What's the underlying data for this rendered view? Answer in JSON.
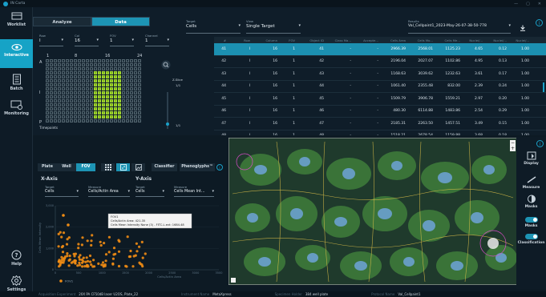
{
  "app": {
    "title": "IN Carta",
    "window_controls": [
      "—",
      "▢",
      "✕"
    ]
  },
  "nav": [
    {
      "id": "worklist",
      "label": "Worklist",
      "icon": "folder-icon"
    },
    {
      "id": "interactive",
      "label": "Interactive",
      "icon": "eye-icon",
      "active": true
    },
    {
      "id": "batch",
      "label": "Batch",
      "icon": "document-icon"
    },
    {
      "id": "monitoring",
      "label": "Monitoring",
      "icon": "monitor-icon"
    },
    {
      "id": "help",
      "label": "Help",
      "icon": "help-icon"
    },
    {
      "id": "settings",
      "label": "Settings",
      "icon": "gear-icon"
    }
  ],
  "view_toggle": {
    "analyze": "Analyze",
    "data": "Data"
  },
  "selectors": {
    "row": {
      "label": "Row",
      "value": "I"
    },
    "col": {
      "label": "Col",
      "value": "16"
    },
    "fov": {
      "label": "FOV",
      "value": "1"
    },
    "channel": {
      "label": "Channel",
      "value": "1"
    }
  },
  "plate": {
    "row_labels": [
      "A",
      "",
      "",
      "",
      "",
      "",
      "",
      "",
      "I",
      "",
      "",
      "",
      "",
      "",
      "",
      "P"
    ],
    "col_labels": [
      "1",
      "8",
      "16",
      "24"
    ],
    "timepoints_label": "Timepoints",
    "timepoints_value": "1/1",
    "zslice_label": "Z-Slice",
    "zslice_value": "1/1"
  },
  "data_header": {
    "target": {
      "label": "Target",
      "value": "Cells"
    },
    "view": {
      "label": "View",
      "value": "Single Target"
    },
    "results": {
      "label": "Results",
      "value": "Val_Cellpaint1_2023-May-26-07-38-50-778"
    }
  },
  "table": {
    "columns": [
      "#",
      "Row",
      "Column",
      "FOV",
      "Object ID",
      "Class Ma...",
      "Accepte...",
      "Cells Area",
      "Cells Mo...",
      "Cells Me...",
      "Nuclei/...",
      "Nuclei/...",
      "Nuclei/..."
    ],
    "rows": [
      [
        "41",
        "I",
        "16",
        "1",
        "41",
        "-",
        "-",
        "2966.39",
        "2568.01",
        "1125.23",
        "4.65",
        "0.12",
        "1.00"
      ],
      [
        "42",
        "I",
        "16",
        "1",
        "42",
        "-",
        "-",
        "2196.04",
        "2027.07",
        "1102.86",
        "4.95",
        "0.13",
        "1.00"
      ],
      [
        "43",
        "I",
        "16",
        "1",
        "43",
        "-",
        "-",
        "1168.63",
        "3039.62",
        "1232.63",
        "3.61",
        "0.17",
        "1.00"
      ],
      [
        "44",
        "I",
        "16",
        "1",
        "44",
        "-",
        "-",
        "1061.40",
        "2355.48",
        "832.00",
        "2.39",
        "0.24",
        "1.00"
      ],
      [
        "45",
        "I",
        "16",
        "1",
        "45",
        "-",
        "-",
        "1509.79",
        "3906.78",
        "1559.21",
        "2.97",
        "0.20",
        "1.00"
      ],
      [
        "46",
        "I",
        "16",
        "1",
        "46",
        "-",
        "-",
        "480.30",
        "6114.88",
        "1483.86",
        "2.54",
        "0.29",
        "1.00"
      ],
      [
        "47",
        "I",
        "16",
        "1",
        "47",
        "-",
        "-",
        "2185.31",
        "2263.50",
        "1457.51",
        "3.49",
        "0.15",
        "1.00"
      ],
      [
        "48",
        "I",
        "16",
        "1",
        "48",
        "-",
        "-",
        "1518.21",
        "2678.54",
        "1159.88",
        "3.68",
        "0.18",
        "1.00"
      ],
      [
        "49",
        "I",
        "16",
        "1",
        "49",
        "-",
        "-",
        "1144.40",
        "3697.48",
        "1353.87",
        "3.39",
        "0.18",
        "1.00"
      ]
    ],
    "selected_index": 0
  },
  "plot_tabs": {
    "plate": "Plate",
    "well": "Well",
    "fov": "FOV",
    "classifier": "Classifier",
    "phenoglyphs": "Phenoglyphs™"
  },
  "axes": {
    "x_title": "X-Axis",
    "y_title": "Y-Axis",
    "x_target": {
      "label": "Target",
      "value": "Cells"
    },
    "x_measure": {
      "label": "Measure",
      "value": "Cells/Actin Area"
    },
    "y_target": {
      "label": "Target",
      "value": "Cells"
    },
    "y_measure": {
      "label": "Measure",
      "value": "Cells Mean Int..."
    }
  },
  "scatter": {
    "xlabel": "Cells/Actin Area",
    "ylabel": "Cells Mean Intensity",
    "legend": "FOV1",
    "x_ticks": [
      "0",
      "500",
      "1000",
      "1500",
      "2000",
      "2500",
      "3000",
      "3500"
    ],
    "y_ticks": [
      "0",
      "1,000",
      "2,000",
      "3,000"
    ],
    "tooltip": {
      "line1": "FOV1",
      "line2": "Cells/Actin Area: 421.35",
      "line3": "Cells Mean Intensity None (3) - FITC-L.evt: 1684.48"
    }
  },
  "image_viewer": {
    "minus": "−",
    "plus": "+"
  },
  "right_panel": [
    {
      "label": "Display",
      "icon": "display-icon"
    },
    {
      "label": "Measure",
      "icon": "ruler-icon"
    },
    {
      "label": "Masks",
      "icon": "masks-icon"
    },
    {
      "label": "Masks",
      "icon": "toggle-icon"
    },
    {
      "label": "Classification",
      "icon": "toggle-icon"
    }
  ],
  "status": {
    "acq_label": "Acquisition Experiment",
    "acq_value": "20X PA CF50dB laser U2OS, Plate_22",
    "inst_label": "Instrument Name",
    "inst_value": "MetaXpress",
    "spec_label": "Specimen Holder",
    "spec_value": "384 well plate",
    "proto_label": "Protocol Name",
    "proto_value": "Val_Cellpaint1"
  }
}
